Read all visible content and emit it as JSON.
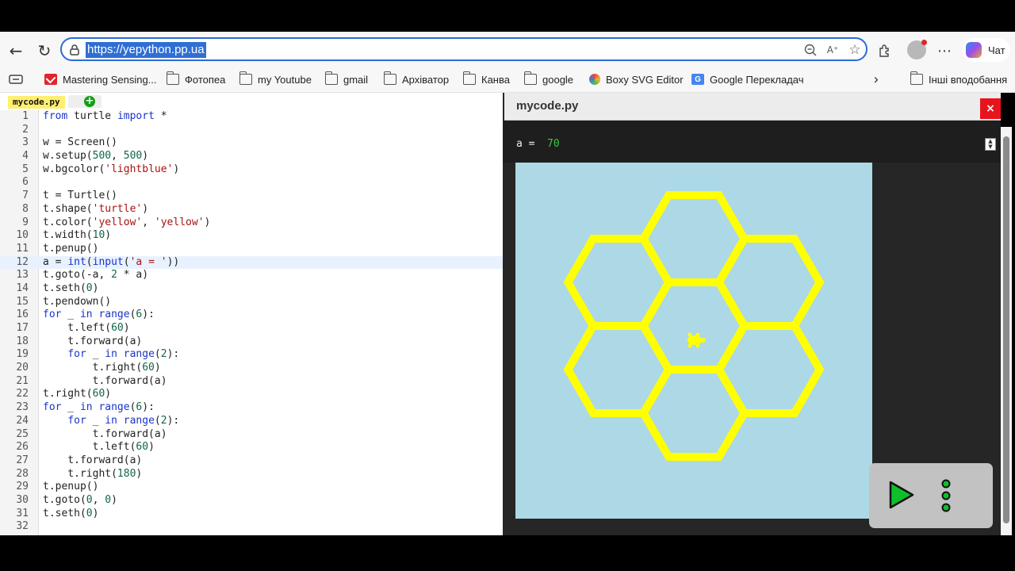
{
  "browser": {
    "url": "https://yepython.pp.ua",
    "copilot_label": "Чат",
    "bookmarks": [
      {
        "label": "Mastering Sensing...",
        "icon": "gmail-icon"
      },
      {
        "label": "Фотопеа",
        "icon": "folder-icon"
      },
      {
        "label": "my Youtube",
        "icon": "folder-icon"
      },
      {
        "label": "gmail",
        "icon": "folder-icon"
      },
      {
        "label": "Архіватор",
        "icon": "folder-icon"
      },
      {
        "label": "Канва",
        "icon": "folder-icon"
      },
      {
        "label": "google",
        "icon": "folder-icon"
      },
      {
        "label": "Boxy SVG Editor",
        "icon": "boxy-icon"
      },
      {
        "label": "Google Перекладач",
        "icon": "google-translate-icon"
      }
    ],
    "other_bookmarks": "Інші вподобання"
  },
  "editor": {
    "tab_name": "mycode.py",
    "lines": [
      "from turtle import *",
      "",
      "w = Screen()",
      "w.setup(500, 500)",
      "w.bgcolor('lightblue')",
      "",
      "t = Turtle()",
      "t.shape('turtle')",
      "t.color('yellow', 'yellow')",
      "t.width(10)",
      "t.penup()",
      "a = int(input('a = '))",
      "t.goto(-a, 2 * a)",
      "t.seth(0)",
      "t.pendown()",
      "for _ in range(6):",
      "    t.left(60)",
      "    t.forward(a)",
      "    for _ in range(2):",
      "        t.right(60)",
      "        t.forward(a)",
      "t.right(60)",
      "for _ in range(6):",
      "    for _ in range(2):",
      "        t.forward(a)",
      "        t.left(60)",
      "    t.forward(a)",
      "    t.right(180)",
      "t.penup()",
      "t.goto(0, 0)",
      "t.seth(0)",
      ""
    ],
    "active_line": 12
  },
  "output": {
    "title": "mycode.py",
    "close_label": "×",
    "prompt": "a = ",
    "answer": "70",
    "canvas_bg": "#add8e6",
    "stroke_color": "#ffff00"
  }
}
